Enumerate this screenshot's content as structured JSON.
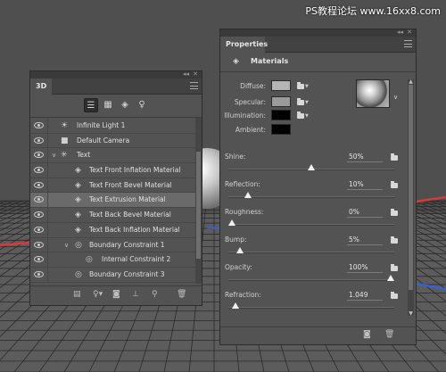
{
  "watermark": "PS教程论坛 www.16xx8.com",
  "colors": {
    "panel_bg": "#535353",
    "selected_row": "#6a6a6a",
    "axis_red": "#d23c3c",
    "axis_blue": "#3c5fd2",
    "diffuse_swatch": "#b5b5b5",
    "specular_swatch": "#9a9a9a",
    "illumination_swatch": "#000000",
    "ambient_swatch": "#000000"
  },
  "panel3d": {
    "tab": "3D",
    "collapse_icon": "double-chevron-icon",
    "filters": [
      "scene-filter-icon",
      "mesh-filter-icon",
      "material-filter-icon",
      "light-filter-icon"
    ],
    "layers": [
      {
        "name": "Infinite Light 1",
        "icon": "sun-icon",
        "indent": 0
      },
      {
        "name": "Default Camera",
        "icon": "camera-icon",
        "indent": 0
      },
      {
        "name": "Text",
        "icon": "mesh-icon",
        "indent": 0,
        "expanded": true
      },
      {
        "name": "Text Front Inflation Material",
        "icon": "material-icon",
        "indent": 1
      },
      {
        "name": "Text Front Bevel Material",
        "icon": "material-icon",
        "indent": 1
      },
      {
        "name": "Text Extrusion Material",
        "icon": "material-icon",
        "indent": 1,
        "selected": true
      },
      {
        "name": "Text Back Bevel Material",
        "icon": "material-icon",
        "indent": 1
      },
      {
        "name": "Text Back Inflation Material",
        "icon": "material-icon",
        "indent": 1
      },
      {
        "name": "Boundary Constraint 1",
        "icon": "constraint-icon",
        "indent": 1,
        "expanded": true
      },
      {
        "name": "Internal Constraint 2",
        "icon": "constraint-icon",
        "indent": 2
      },
      {
        "name": "Boundary Constraint 3",
        "icon": "constraint-icon",
        "indent": 1
      }
    ],
    "bottom_buttons": [
      "render-icon",
      "add-light-icon",
      "material-icon",
      "drop-to-plane-icon",
      "scene-icon",
      "delete-icon"
    ]
  },
  "properties": {
    "tab": "Properties",
    "title": "Materials",
    "material_rows": [
      {
        "label": "Diffuse:",
        "swatch": "#b5b5b5"
      },
      {
        "label": "Specular:",
        "swatch": "#9a9a9a"
      },
      {
        "label": "Illumination:",
        "swatch": "#000000"
      },
      {
        "label": "Ambient:",
        "swatch": "#000000"
      }
    ],
    "sliders": [
      {
        "label": "Shine:",
        "value": "50%",
        "level": 0.5
      },
      {
        "label": "Reflection:",
        "value": "10%",
        "level": 0.1
      },
      {
        "label": "Roughness:",
        "value": "0%",
        "level": 0.0
      },
      {
        "label": "Bump:",
        "value": "5%",
        "level": 0.05
      },
      {
        "label": "Opacity:",
        "value": "100%",
        "level": 1.0
      },
      {
        "label": "Refraction:",
        "value": "1.049",
        "level": 0.02
      }
    ],
    "bottom_buttons": [
      "new-material-icon",
      "delete-icon"
    ]
  }
}
